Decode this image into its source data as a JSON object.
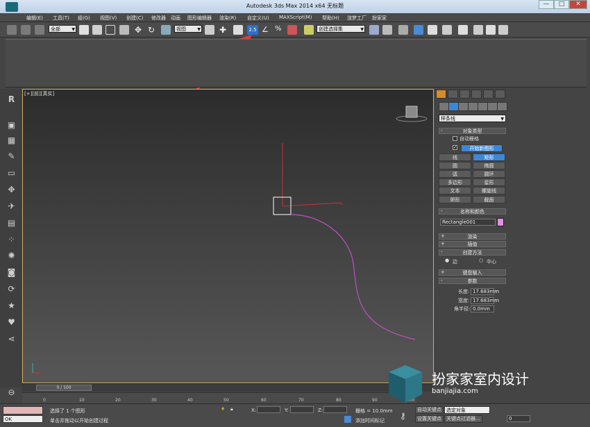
{
  "window": {
    "title": "Autodesk 3ds Max  2014 x64      无标题",
    "min": "—",
    "max": "□",
    "close": "✕"
  },
  "menu": [
    "编辑(E)",
    "工具(T)",
    "组(G)",
    "视图(V)",
    "创建(C)",
    "修改器",
    "动画",
    "图形编辑器",
    "渲染(R)",
    "自定义(U)",
    "MAXScript(M)",
    "帮助(H)",
    "渲梦工厂",
    "扮家家"
  ],
  "toolbar": {
    "selection_filter": "全部",
    "reference_coord": "视图",
    "snap_toggle": "2.5",
    "named_selection": "创建选择集"
  },
  "viewport": {
    "label": "[+][前][真实]",
    "axis_x": "x",
    "axis_y": "y"
  },
  "command_panel": {
    "category_dropdown": "样条线",
    "object_type": {
      "header": "对象类型",
      "autogrid": "自动栅格",
      "start_new_shape": "开始新图形",
      "buttons": [
        "线",
        "矩形",
        "圆",
        "椭圆",
        "弧",
        "圆环",
        "多边形",
        "星形",
        "文本",
        "螺旋线",
        "卵形",
        "截面"
      ]
    },
    "name_color": {
      "header": "名称和颜色",
      "object_name": "Rectangle001",
      "color": "#e68ce6"
    },
    "rendering": "渲染",
    "interpolation": "插值",
    "creation_method": {
      "header": "创建方法",
      "opt_edge": "边",
      "opt_center": "中心"
    },
    "keyboard_entry": "键盘输入",
    "parameters": {
      "header": "参数",
      "length_label": "长度:",
      "length_value": "17.683mm",
      "width_label": "宽度:",
      "width_value": "17.683mm",
      "corner_label": "角半径:",
      "corner_value": "0.0mm"
    }
  },
  "timeline": {
    "slider": "0 / 100",
    "ticks": [
      "0",
      "10",
      "20",
      "30",
      "40",
      "50",
      "60",
      "70",
      "80",
      "90",
      "100"
    ]
  },
  "status": {
    "script_field": "OK",
    "selection_text": "选择了 1 个图形",
    "prompt": "单击并拖动以开始创建过程",
    "x_label": "X:",
    "y_label": "Y:",
    "z_label": "Z:",
    "grid": "栅格 = 10.0mm",
    "auto_key": "自动关键点",
    "set_key": "设置关键点",
    "selected_object": "选定对象",
    "key_filters": "关键点过滤器...",
    "add_time_tag": "添加时间标记",
    "frame": "0"
  },
  "watermark": {
    "text": "扮家家室内设计",
    "url": "banjiajia.com"
  }
}
